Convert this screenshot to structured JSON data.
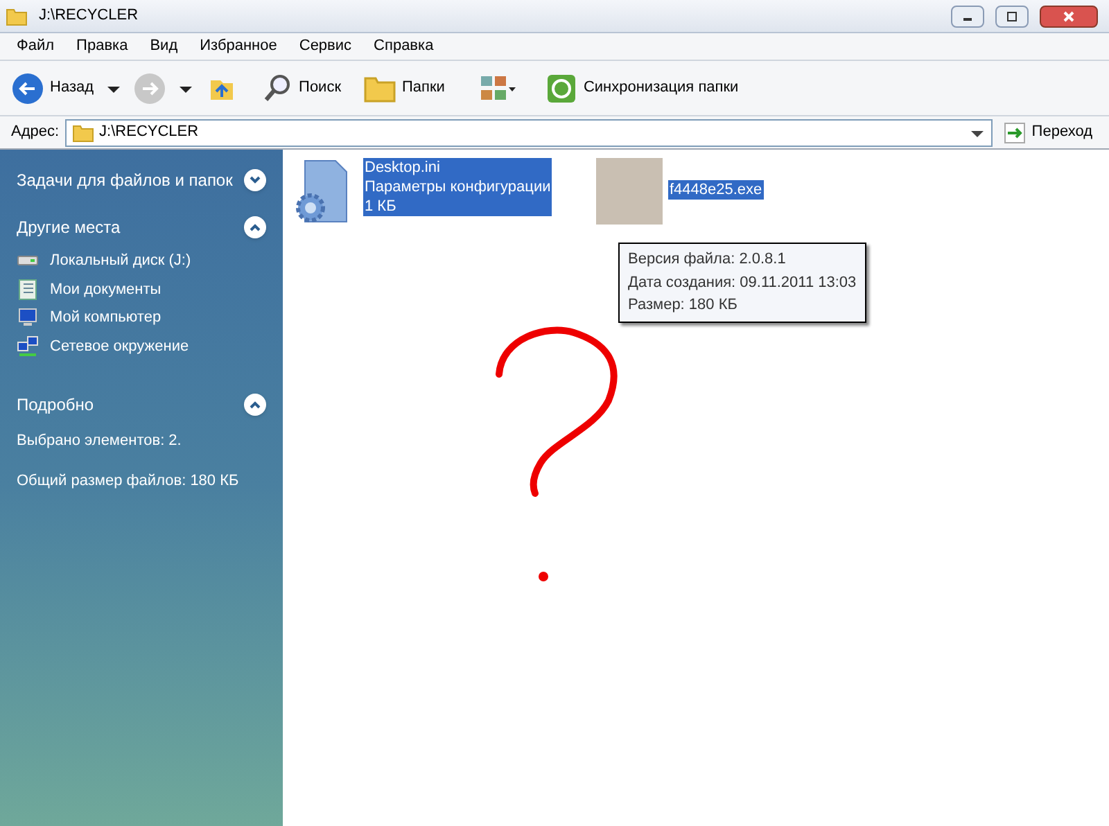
{
  "window": {
    "title": "J:\\RECYCLER"
  },
  "menu": [
    "Файл",
    "Правка",
    "Вид",
    "Избранное",
    "Сервис",
    "Справка"
  ],
  "toolbar": {
    "back": "Назад",
    "search": "Поиск",
    "folders": "Папки",
    "sync": "Синхронизация папки"
  },
  "address": {
    "label": "Адрес:",
    "value": "J:\\RECYCLER",
    "go": "Переход"
  },
  "sidebar": {
    "sections": [
      {
        "title": "Задачи для файлов и папок",
        "expanded": false
      },
      {
        "title": "Другие места",
        "expanded": true,
        "items": [
          {
            "label": "Локальный диск (J:)",
            "kind": "drive"
          },
          {
            "label": "Мои документы",
            "kind": "documents"
          },
          {
            "label": "Мой компьютер",
            "kind": "computer"
          },
          {
            "label": "Сетевое окружение",
            "kind": "network"
          }
        ]
      },
      {
        "title": "Подробно",
        "expanded": true,
        "lines": [
          "Выбрано элементов: 2.",
          "Общий размер файлов: 180 КБ"
        ]
      }
    ]
  },
  "files": [
    {
      "kind": "settings",
      "selected": true,
      "lines": [
        "Desktop.ini",
        "Параметры конфигурации",
        "1 КБ"
      ]
    },
    {
      "kind": "photo",
      "selected": true,
      "lines": [
        "f4448e25.exe"
      ]
    }
  ],
  "tooltip": [
    "Версия файла: 2.0.8.1",
    "Дата создания: 09.11.2011 13:03",
    "Размер: 180 КБ"
  ]
}
